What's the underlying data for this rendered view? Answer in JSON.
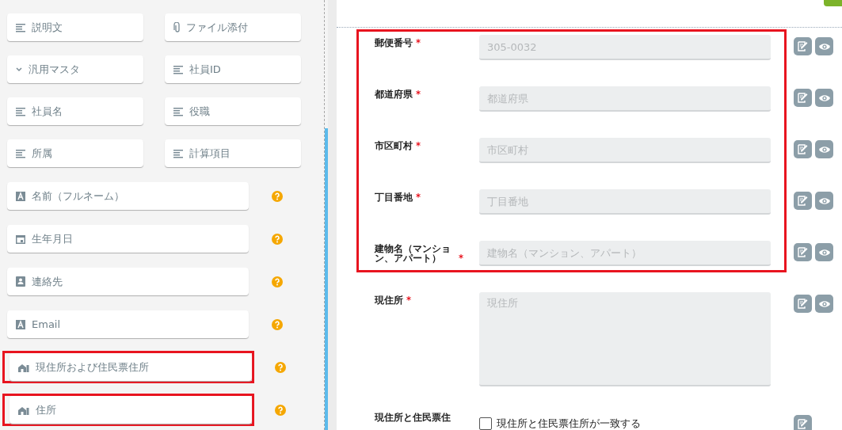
{
  "palette": {
    "pairs": [
      {
        "label": "説明文",
        "kind": "lines"
      },
      {
        "label": "ファイル添付",
        "kind": "clip"
      },
      {
        "label": "汎用マスタ",
        "kind": "chevron"
      },
      {
        "label": "社員ID",
        "kind": "lines"
      },
      {
        "label": "社員名",
        "kind": "lines"
      },
      {
        "label": "役職",
        "kind": "lines"
      },
      {
        "label": "所属",
        "kind": "lines"
      },
      {
        "label": "計算項目",
        "kind": "lines"
      }
    ],
    "fields": [
      {
        "label": "名前（フルネーム）",
        "kind": "letter",
        "highlighted": false
      },
      {
        "label": "生年月日",
        "kind": "calendar",
        "highlighted": false
      },
      {
        "label": "連絡先",
        "kind": "contact",
        "highlighted": false
      },
      {
        "label": "Email",
        "kind": "letter",
        "highlighted": false
      },
      {
        "label": "現住所および住民票住所",
        "kind": "house",
        "highlighted": true
      },
      {
        "label": "住所",
        "kind": "house",
        "highlighted": true
      }
    ]
  },
  "form": {
    "groups": [
      {
        "highlighted": true,
        "rows": [
          {
            "label": "郵便番号",
            "required_mark": "*",
            "kind": "input",
            "placeholder": "305-0032",
            "viewable": true
          },
          {
            "label": "都道府県",
            "required_mark": "*",
            "kind": "input",
            "placeholder": "都道府県",
            "viewable": true
          },
          {
            "label": "市区町村",
            "required_mark": "*",
            "kind": "input",
            "placeholder": "市区町村",
            "viewable": true
          },
          {
            "label": "丁目番地",
            "required_mark": "*",
            "kind": "input",
            "placeholder": "丁目番地",
            "viewable": true
          },
          {
            "label": "建物名（マンション、アパート）",
            "required_mark": "*",
            "kind": "input",
            "placeholder": "建物名（マンション、アパート）",
            "viewable": true
          }
        ]
      },
      {
        "highlighted": false,
        "rows": [
          {
            "label": "現住所",
            "required_mark": "*",
            "kind": "textarea",
            "placeholder": "現住所",
            "viewable": true
          },
          {
            "label": "現住所と住民票住",
            "kind": "checkbox",
            "option": "現住所と住民票住所が一致する",
            "checked": false,
            "viewable": false
          }
        ]
      }
    ]
  }
}
